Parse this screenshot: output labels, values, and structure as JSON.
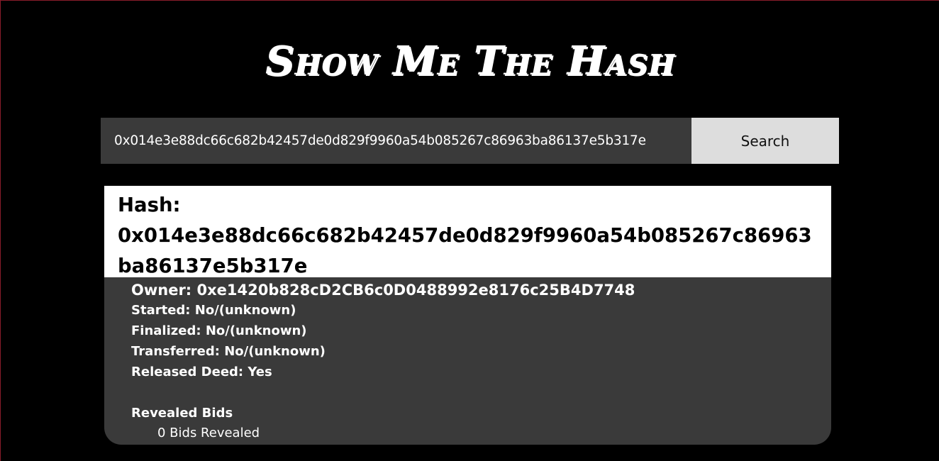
{
  "page": {
    "title": "Show Me The Hash"
  },
  "search": {
    "value": "0x014e3e88dc66c682b42457de0d829f9960a54b085267c86963ba86137e5b317e",
    "button_label": "Search"
  },
  "result": {
    "hash_label": "Hash:",
    "hash_value": "0x014e3e88dc66c682b42457de0d829f9960a54b085267c86963ba86137e5b317e",
    "owner_label": "Owner:",
    "owner_value": "0xe1420b828cD2CB6c0D0488992e8176c25B4D7748",
    "started_label": "Started:",
    "started_value": "No/(unknown)",
    "finalized_label": "Finalized:",
    "finalized_value": "No/(unknown)",
    "transferred_label": "Transferred:",
    "transferred_value": "No/(unknown)",
    "released_deed_label": "Released Deed:",
    "released_deed_value": "Yes",
    "revealed_bids_heading": "Revealed Bids",
    "bids_revealed_text": "0 Bids Revealed"
  },
  "colors": {
    "background": "#000000",
    "input_background": "#3a3a3a",
    "button_background": "#dddddd",
    "card_background": "#3a3a3a",
    "hash_header_background": "#ffffff",
    "text_light": "#ffffff",
    "text_dark": "#000000"
  }
}
